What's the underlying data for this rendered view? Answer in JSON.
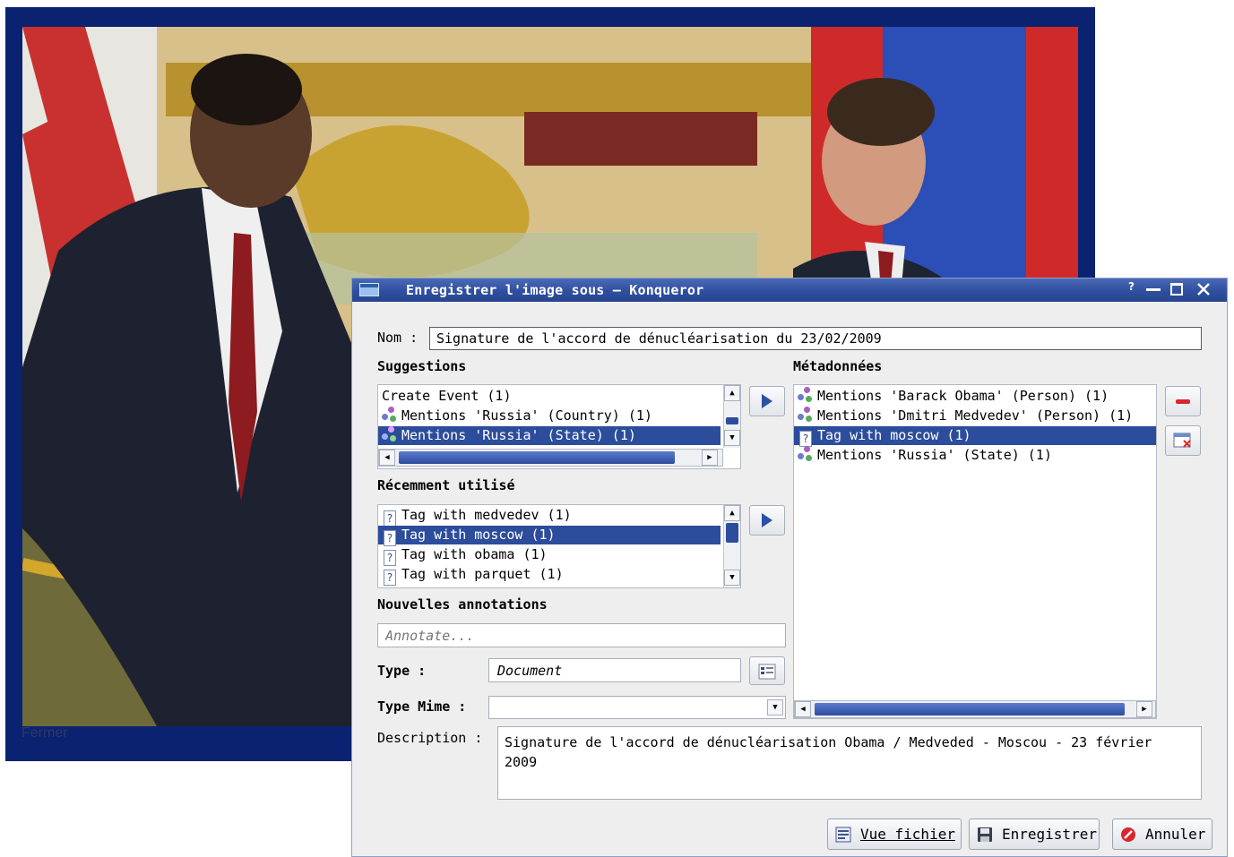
{
  "viewer": {
    "close_link": "Fermer"
  },
  "dialog": {
    "title": "Enregistrer l'image sous – Konqueror",
    "help_glyph": "?",
    "name_label": "Nom :",
    "name_value": "Signature de l'accord de dénucléarisation du 23/02/2009",
    "suggestions": {
      "heading": "Suggestions",
      "items": [
        {
          "label": "Create Event  (1)",
          "icon": "",
          "selected": false
        },
        {
          "label": "Mentions 'Russia' (Country) (1)",
          "icon": "graph-icon",
          "selected": false
        },
        {
          "label": "Mentions 'Russia' (State) (1)",
          "icon": "graph-icon",
          "selected": true
        }
      ]
    },
    "recent": {
      "heading": "Récemment utilisé",
      "items": [
        {
          "label": "Tag with medvedev (1)",
          "icon": "tag-icon",
          "selected": false
        },
        {
          "label": "Tag with moscow (1)",
          "icon": "tag-icon",
          "selected": true
        },
        {
          "label": "Tag with obama (1)",
          "icon": "tag-icon",
          "selected": false
        },
        {
          "label": "Tag with parquet (1)",
          "icon": "tag-icon",
          "selected": false
        }
      ]
    },
    "new_annotations": {
      "heading": "Nouvelles annotations",
      "placeholder": "Annotate..."
    },
    "type_label": "Type :",
    "type_value": "Document",
    "mime_label": "Type Mime :",
    "mime_value": "",
    "metadata": {
      "heading": "Métadonnées",
      "items": [
        {
          "label": "Mentions 'Barack Obama' (Person) (1)",
          "icon": "graph-icon",
          "selected": false
        },
        {
          "label": "Mentions 'Dmitri Medvedev' (Person) (1)",
          "icon": "graph-icon",
          "selected": false
        },
        {
          "label": "Tag with moscow (1)",
          "icon": "tag-icon",
          "selected": true
        },
        {
          "label": "Mentions 'Russia' (State) (1)",
          "icon": "graph-icon",
          "selected": false
        }
      ]
    },
    "description_label": "Description :",
    "description_value": "Signature de l'accord de dénucléarisation Obama / Medveded - Moscou - 23 février 2009",
    "buttons": {
      "view_file": "Vue fichier",
      "save": "Enregistrer",
      "cancel": "Annuler"
    },
    "colors": {
      "titlebar": "#2f4f9f",
      "selection": "#2c4c9c",
      "viewer_frame": "#0b2270"
    }
  }
}
